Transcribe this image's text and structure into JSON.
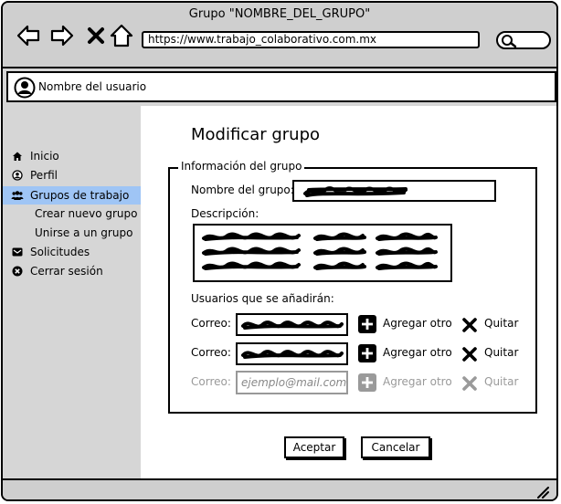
{
  "window": {
    "title": "Grupo \"NOMBRE_DEL_GRUPO\""
  },
  "browser": {
    "url": "https://www.trabajo_colaborativo.com.mx"
  },
  "user": {
    "name": "Nombre del usuario"
  },
  "sidebar": {
    "items": [
      {
        "label": "Inicio",
        "icon": "home-icon"
      },
      {
        "label": "Perfil",
        "icon": "user-circle-icon"
      },
      {
        "label": "Grupos de trabajo",
        "icon": "users-icon",
        "active": true
      },
      {
        "label": "Solicitudes",
        "icon": "envelope-icon"
      },
      {
        "label": "Cerrar sesión",
        "icon": "close-circle-icon"
      }
    ],
    "subitems": [
      {
        "label": "Crear nuevo grupo"
      },
      {
        "label": "Unirse a un grupo"
      }
    ],
    "active_color": "#9fc5f5"
  },
  "form": {
    "title": "Modificar grupo",
    "legend": "Información del grupo",
    "name_label": "Nombre del grupo:",
    "description_label": "Descripción:",
    "users_label": "Usuarios que se añadirán:",
    "emails": [
      {
        "label": "Correo:",
        "add_label": "Agregar otro",
        "remove_label": "Quitar"
      },
      {
        "label": "Correo:",
        "add_label": "Agregar otro",
        "remove_label": "Quitar"
      },
      {
        "label": "Correo:",
        "placeholder": "ejemplo@mail.com",
        "add_label": "Agregar otro",
        "remove_label": "Quitar",
        "disabled": true
      }
    ],
    "accept_label": "Aceptar",
    "cancel_label": "Cancelar"
  }
}
